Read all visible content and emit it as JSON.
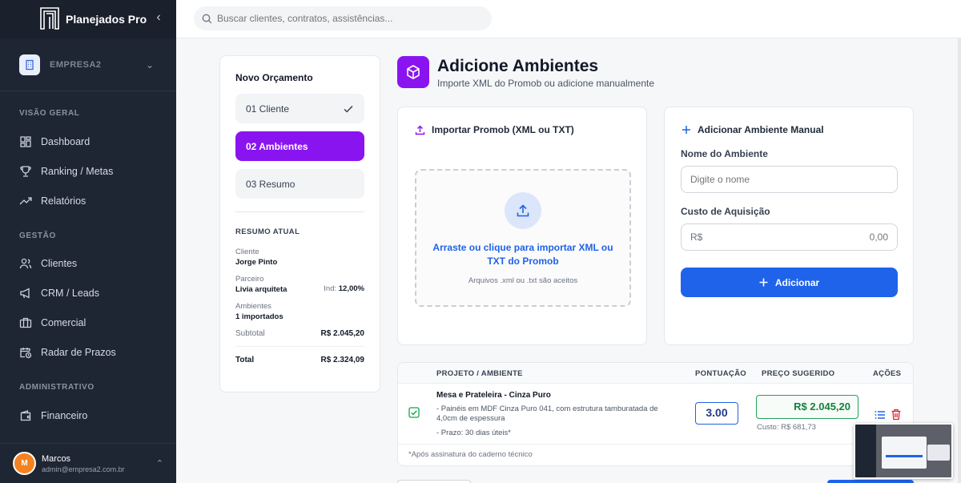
{
  "app": {
    "name": "Planejados Pro",
    "company": "EMPRESA2"
  },
  "search": {
    "placeholder": "Buscar clientes, contratos, assistências..."
  },
  "sidebar": {
    "sections": [
      {
        "title": "VISÃO GERAL",
        "items": [
          {
            "label": "Dashboard",
            "icon": "dashboard-icon"
          },
          {
            "label": "Ranking / Metas",
            "icon": "trophy-icon"
          },
          {
            "label": "Relatórios",
            "icon": "trend-icon"
          }
        ]
      },
      {
        "title": "GESTÃO",
        "items": [
          {
            "label": "Clientes",
            "icon": "users-icon"
          },
          {
            "label": "CRM / Leads",
            "icon": "megaphone-icon"
          },
          {
            "label": "Comercial",
            "icon": "briefcase-icon"
          },
          {
            "label": "Radar de Prazos",
            "icon": "calendar-clock-icon"
          }
        ]
      },
      {
        "title": "ADMINISTRATIVO",
        "items": [
          {
            "label": "Financeiro",
            "icon": "wallet-icon"
          }
        ]
      }
    ]
  },
  "user": {
    "initial": "M",
    "name": "Marcos",
    "email": "admin@empresa2.com.br"
  },
  "steps": {
    "title": "Novo Orçamento",
    "items": [
      {
        "label": "01 Cliente",
        "state": "done"
      },
      {
        "label": "02 Ambientes",
        "state": "active"
      },
      {
        "label": "03 Resumo",
        "state": "pending"
      }
    ]
  },
  "summary": {
    "title": "RESUMO ATUAL",
    "client_label": "Cliente",
    "client_value": "Jorge Pinto",
    "partner_label": "Parceiro",
    "partner_value": "Livia arquiteta",
    "ind_label": "Ind:",
    "ind_value": "12,00%",
    "ambientes_label": "Ambientes",
    "ambientes_value": "1 importados",
    "subtotal_label": "Subtotal",
    "subtotal_value": "R$ 2.045,20",
    "total_label": "Total",
    "total_value": "R$ 2.324,09"
  },
  "header": {
    "title": "Adicione Ambientes",
    "subtitle": "Importe XML do Promob ou adicione manualmente"
  },
  "import": {
    "title": "Importar Promob (XML ou TXT)",
    "drop_text": "Arraste ou clique para importar XML ou TXT do Promob",
    "drop_sub": "Arquivos .xml ou .txt são aceitos"
  },
  "manual": {
    "title": "Adicionar Ambiente Manual",
    "name_label": "Nome do Ambiente",
    "name_placeholder": "Digite o nome",
    "cost_label": "Custo de Aquisição",
    "currency": "R$",
    "cost_placeholder": "0,00",
    "button": "Adicionar"
  },
  "table": {
    "headers": {
      "project": "PROJETO / AMBIENTE",
      "score": "PONTUAÇÃO",
      "price": "PREÇO SUGERIDO",
      "actions": "AÇÕES"
    },
    "rows": [
      {
        "title": "Mesa e Prateleira - Cinza Puro",
        "desc": "- Painéis em MDF Cinza Puro 041, com estrutura tamburatada de 4,0cm de espessura",
        "prazo": "- Prazo: 30 dias úteis*",
        "score": "3.00",
        "price": "R$ 2.045,20",
        "cost": "Custo: R$ 681,73"
      }
    ],
    "footnote": "*Após assinatura do caderno técnico"
  },
  "colors": {
    "accent": "#8a14f0",
    "primary": "#1f63ea",
    "sidebar": "#1e2533",
    "success": "#15803d"
  }
}
